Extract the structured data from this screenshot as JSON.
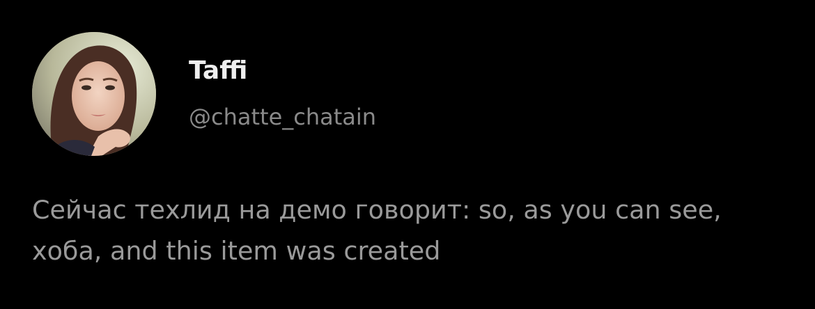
{
  "tweet": {
    "author": {
      "display_name": "Taffi",
      "handle": "@chatte_chatain",
      "avatar_icon": "user-avatar-photo"
    },
    "text": "Сейчас техлид на демо говорит: so, as you can see, хоба, and this item was created"
  },
  "colors": {
    "background": "#000000",
    "name": "#eeeeee",
    "handle": "#8a8a8a",
    "body": "#9a9a9a"
  }
}
